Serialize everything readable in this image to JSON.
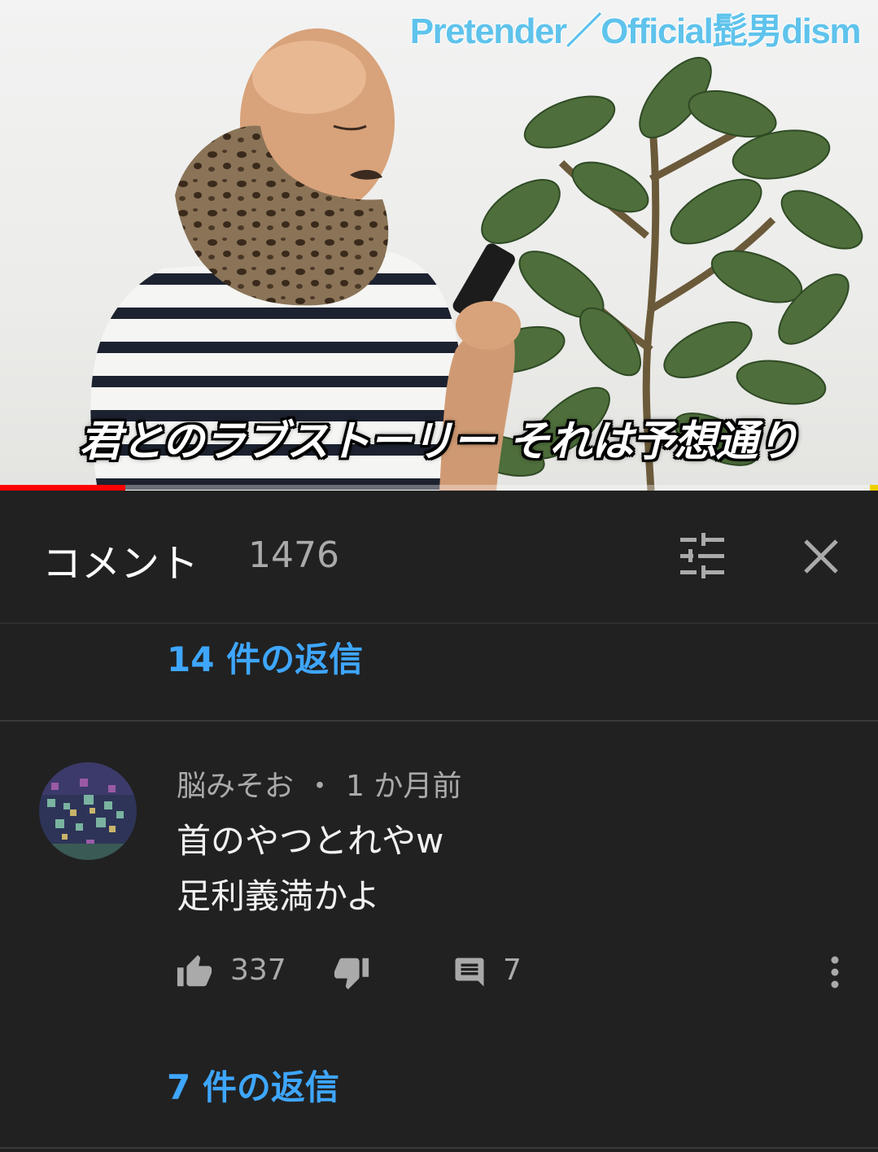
{
  "video": {
    "title_overlay": "Pretender／Official髭男dism",
    "lyric_subtitle": "君とのラブストーリー それは予想通り",
    "progress_fraction": 0.143,
    "colors": {
      "progress": "#ff0000",
      "title": "#5fc3ec"
    }
  },
  "comments": {
    "title": "コメント",
    "count": "1476",
    "filter_icon": "sort-sliders-icon",
    "close_icon": "close-icon",
    "replies_link_1": "14 件の返信",
    "comment": {
      "author": "脳みそお",
      "separator": "・",
      "time": "1 か月前",
      "lines": [
        "首のやつとれやw",
        "足利義満かよ"
      ],
      "likes": "337",
      "replies_count": "7",
      "icons": {
        "like": "thumbs-up-icon",
        "dislike": "thumbs-down-icon",
        "reply": "comment-icon",
        "more": "more-vertical-icon"
      }
    },
    "replies_link_2": "7 件の返信",
    "accent_color": "#3ea6ff"
  }
}
